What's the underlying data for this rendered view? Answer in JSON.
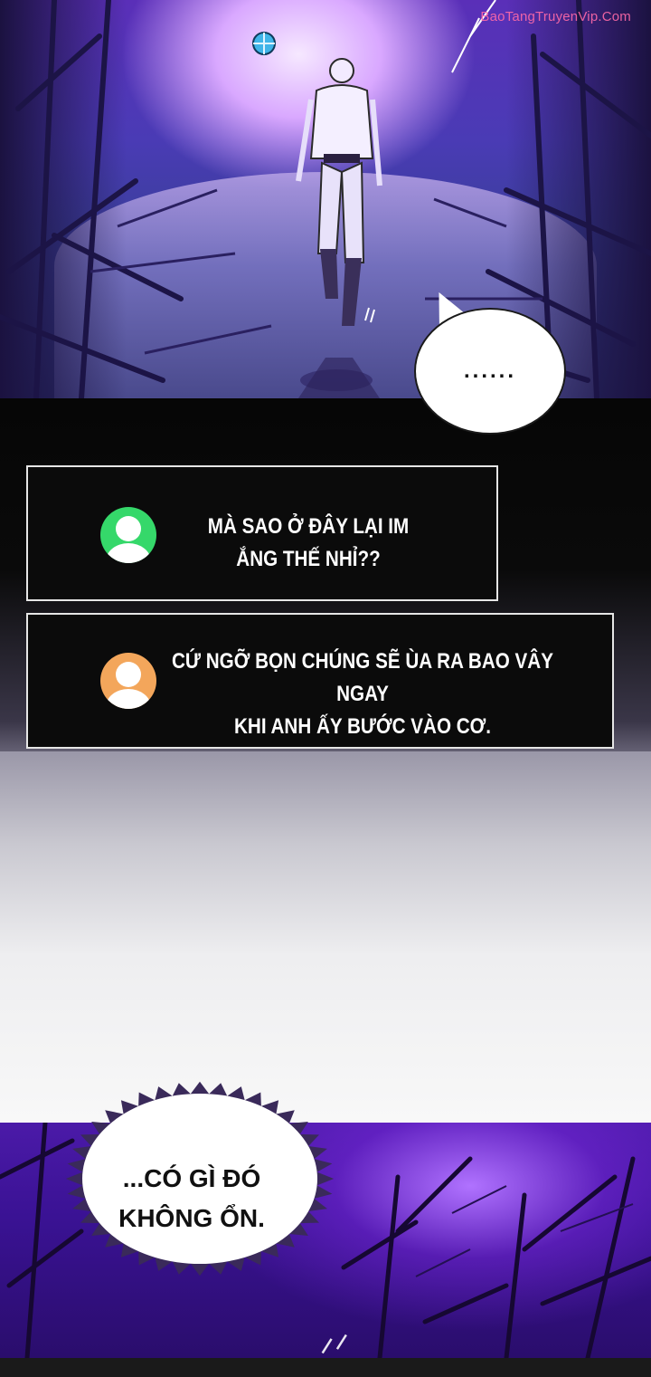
{
  "watermark": "BaoTangTruyenVip.Com",
  "bubble": {
    "text": "......"
  },
  "chat": [
    {
      "avatar": "green-person-icon",
      "avatar_color": "#35d86a",
      "lines": [
        "MÀ SAO Ở ĐÂY LẠI IM",
        "ẮNG THẾ NHỈ??"
      ]
    },
    {
      "avatar": "orange-person-icon",
      "avatar_color": "#f3a65b",
      "lines": [
        "CỨ NGỠ BỌN CHÚNG SẼ ÙA RA BAO VÂY NGAY",
        "KHI ANH ẤY BƯỚC VÀO CƠ."
      ]
    }
  ],
  "thought": {
    "lines": [
      "...CÓ GÌ ĐÓ",
      "KHÔNG ỔN."
    ]
  },
  "sfx": "ᐟᐟ",
  "colors": {
    "forest_purple": "#5a2fb8",
    "glow": "#f6e8ff",
    "chat_border": "#e6e6e6",
    "chat_bg": "#0b0b0b"
  }
}
